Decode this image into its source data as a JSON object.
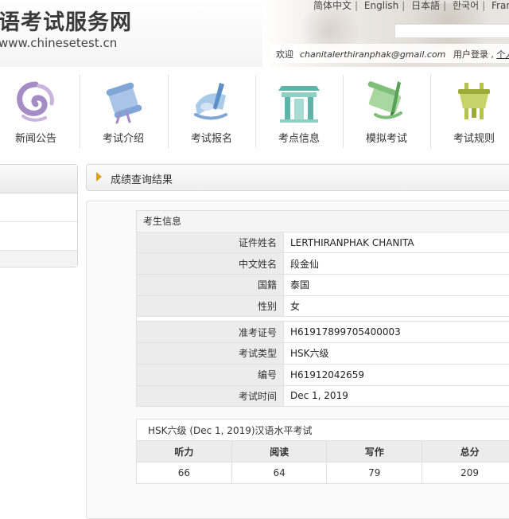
{
  "header": {
    "site_title": "语考试服务网",
    "site_url": "www.chinesetest.cn",
    "languages": [
      "简体中文",
      "English",
      "日本語",
      "한국어",
      "Français",
      "F"
    ],
    "welcome": "欢迎",
    "email": "chanitalerthiranphak@gmail.com",
    "user_login": "用户登录",
    "personal_info": "个人信息"
  },
  "nav": [
    {
      "label": "新闻公告",
      "icon": "news-swirl-icon"
    },
    {
      "label": "考试介绍",
      "icon": "scroll-icon"
    },
    {
      "label": "考试报名",
      "icon": "registration-icon"
    },
    {
      "label": "考点信息",
      "icon": "temple-gate-icon"
    },
    {
      "label": "模拟考试",
      "icon": "brush-scroll-icon"
    },
    {
      "label": "考试规则",
      "icon": "ding-vessel-icon"
    }
  ],
  "results": {
    "title": "成绩查询结果",
    "section_title": "考生信息",
    "fields": [
      {
        "label": "证件姓名",
        "value": "LERTHIRANPHAK CHANITA"
      },
      {
        "label": "中文姓名",
        "value": "段金仙"
      },
      {
        "label": "国籍",
        "value": "泰国"
      },
      {
        "label": "性别",
        "value": "女"
      },
      {
        "label": "准考证号",
        "value": "H61917899705400003"
      },
      {
        "label": "考试类型",
        "value": "HSK六级"
      },
      {
        "label": "编号",
        "value": "H61912042659"
      },
      {
        "label": "考试时间",
        "value": "Dec 1, 2019"
      }
    ],
    "score_title": "HSK六级 (Dec 1, 2019)汉语水平考试",
    "score_headers": [
      "听力",
      "阅读",
      "写作",
      "总分"
    ],
    "score_values": [
      "66",
      "64",
      "79",
      "209"
    ]
  },
  "colors": {
    "accent_arrow": "#e0a019",
    "icon_purple": "#a58cc4",
    "icon_blue": "#7fa6d6",
    "icon_teal": "#5fb3a8",
    "icon_green": "#7fbf7a",
    "icon_olive": "#b2c24c"
  }
}
